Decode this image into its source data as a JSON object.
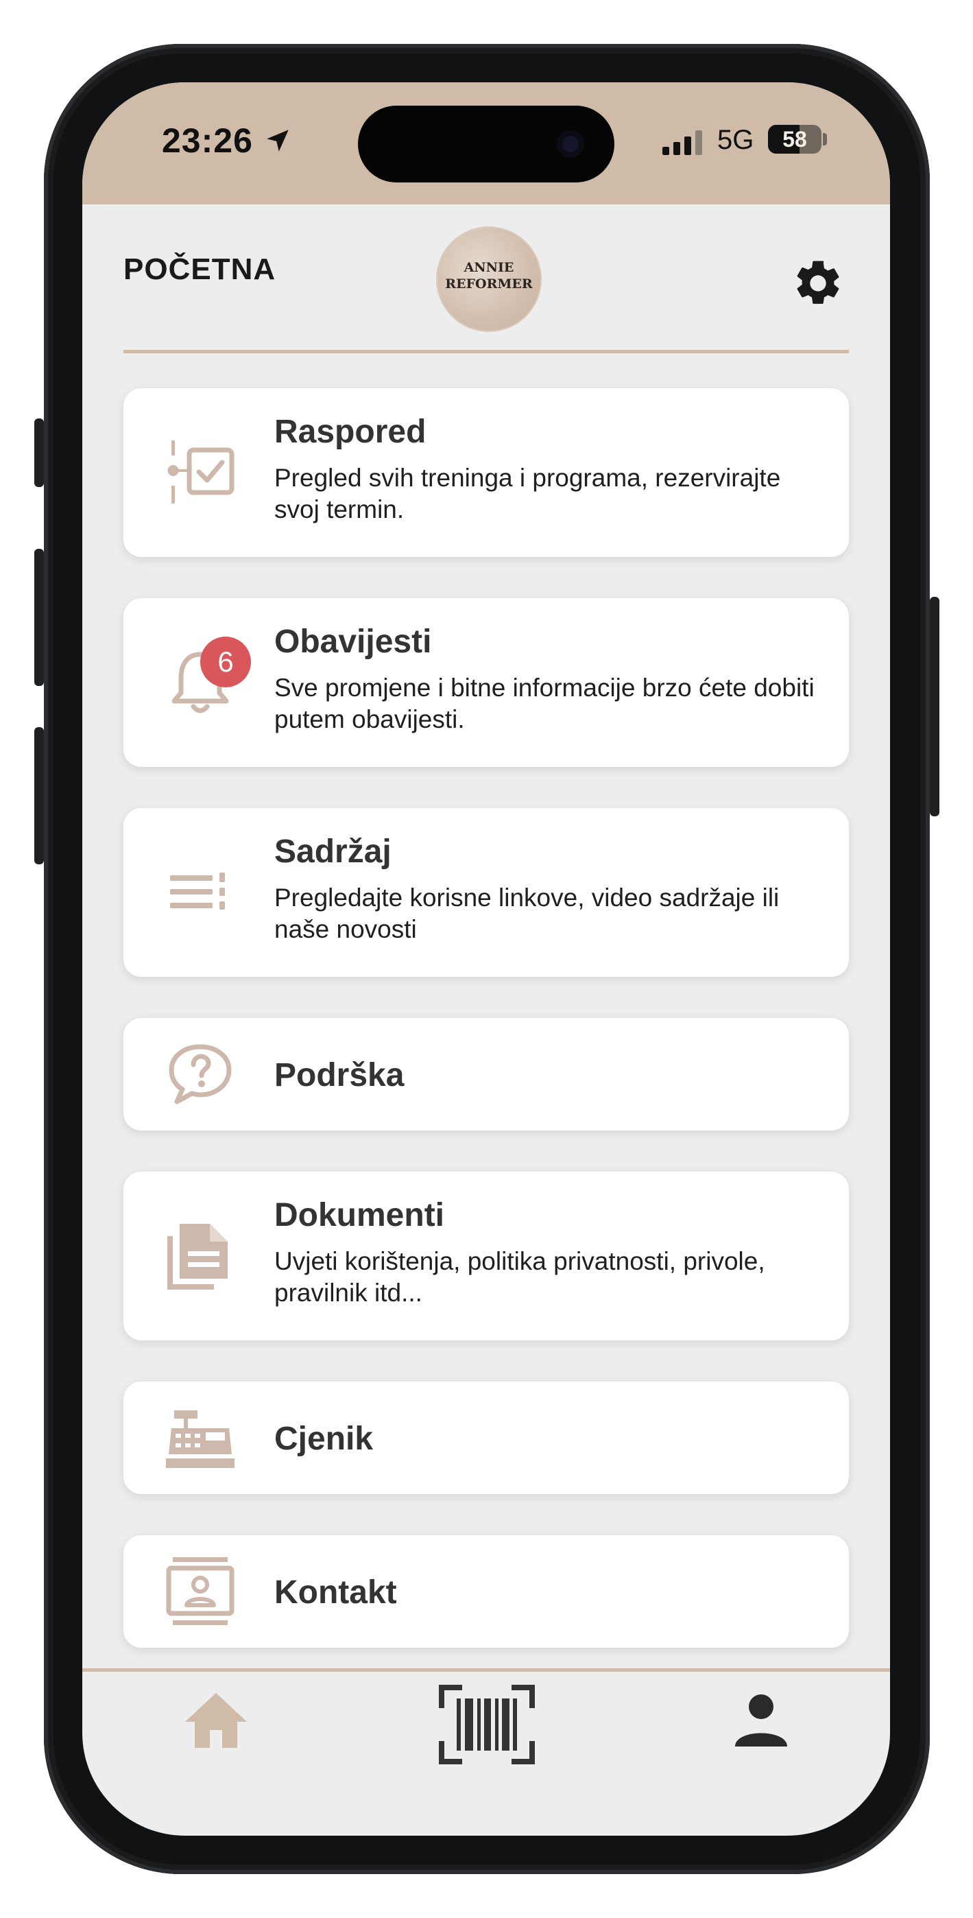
{
  "status_bar": {
    "time": "23:26",
    "network": "5G",
    "battery": "58",
    "icons": [
      "location-arrow-icon",
      "signal-icon",
      "battery-icon"
    ]
  },
  "header": {
    "title": "POČETNA",
    "logo_line1": "ANNIE",
    "logo_line2": "REFORMER",
    "settings_icon": "gear-icon"
  },
  "menu": {
    "items": [
      {
        "title": "Raspored",
        "desc": "Pregled svih treninga i programa, rezervirajte svoj termin.",
        "icon": "schedule-check-icon"
      },
      {
        "title": "Obavijesti",
        "desc": "Sve promjene i bitne informacije brzo ćete dobiti putem obavijesti.",
        "icon": "bell-icon",
        "badge": "6"
      },
      {
        "title": "Sadržaj",
        "desc": "Pregledajte korisne linkove, video sadržaje ili naše novosti",
        "icon": "list-icon"
      },
      {
        "title": "Podrška",
        "desc": "",
        "icon": "help-bubble-icon"
      },
      {
        "title": "Dokumenti",
        "desc": "Uvjeti korištenja, politika privatnosti, privole, pravilnik itd...",
        "icon": "documents-icon"
      },
      {
        "title": "Cjenik",
        "desc": "",
        "icon": "cash-register-icon"
      },
      {
        "title": "Kontakt",
        "desc": "",
        "icon": "contact-card-icon"
      }
    ]
  },
  "tabbar": {
    "icons": [
      "home-icon",
      "barcode-icon",
      "profile-icon"
    ]
  },
  "colors": {
    "accent": "#cfbba8",
    "icon": "#cdb8ab",
    "badge": "#d9575a",
    "background": "#ededed",
    "card": "#ffffff",
    "text": "#333333"
  }
}
